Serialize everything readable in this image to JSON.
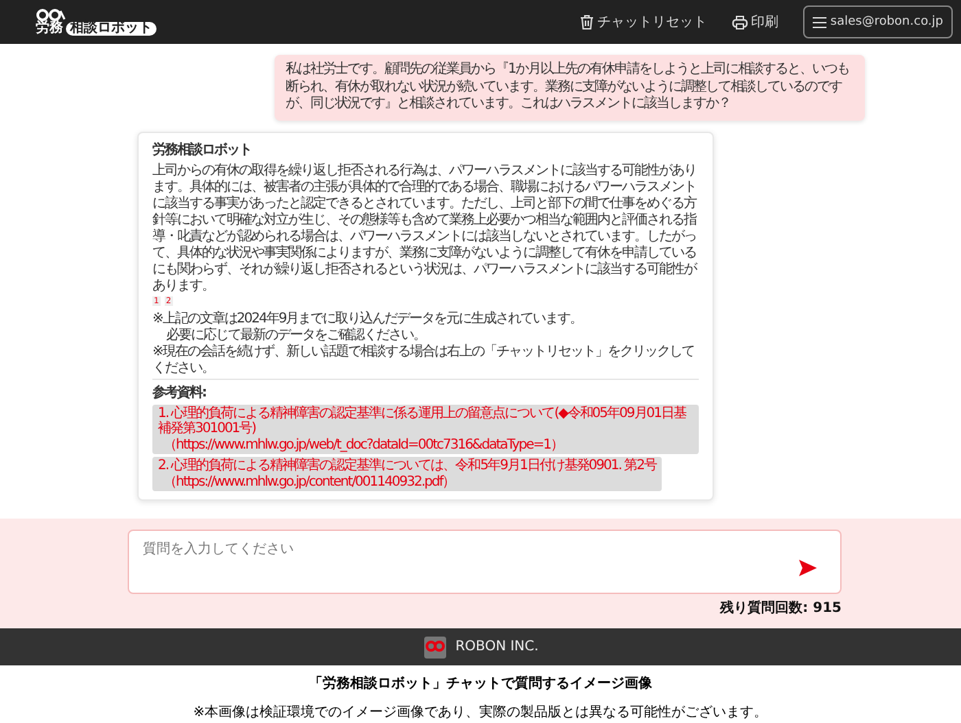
{
  "header": {
    "logo": {
      "top": "労務",
      "tag": "相談ロボット"
    },
    "actions": [
      {
        "kind": "reset",
        "label": "チャットリセット"
      },
      {
        "kind": "print",
        "label": "印刷"
      }
    ],
    "account": "sales@robon.co.jp"
  },
  "user_message": "私は社労士です。顧問先の従業員から『1か月以上先の有休申請をしようと上司に相談すると、いつも断られ、有休が取れない状況が続いています。業務に支障がないように調整して相談しているのですが、同じ状況です』と相談されています。これはハラスメントに該当しますか？",
  "bot_message": {
    "sender": "労務相談ロボット",
    "answer": "上司からの有休の取得を繰り返し拒否される行為は、パワーハラスメントに該当する可能性があります。具体的には、被害者の主張が具体的で合理的である場合、職場におけるパワーハラスメントに該当する事実があったと認定できるとされています。ただし、上司と部下の間で仕事をめぐる方針等において明確な対立が生じ、その態様等も含めて業務上必要かつ相当な範囲内と評価される指導・叱責などが認められる場合は、パワーハラスメントには該当しないとされています。したがって、具体的な状況や事実関係によりますが、業務に支障がないように調整して有休を申請しているにも関わらず、それが繰り返し拒否されるという状況は、パワーハラスメントに該当する可能性があります。",
    "citations": [
      "1",
      "2"
    ],
    "notes": [
      "※上記の文章は2024年9月までに取り込んだデータを元に生成されています。",
      "必要に応じて最新のデータをご確認ください。",
      "※現在の会話を続けず、新しい話題で相談する場合は右上の「チャットリセット」をクリックしてください。"
    ],
    "references_title": "参考資料:",
    "references": [
      {
        "title": "1. 心理的負荷による精神障害の認定基準に係る運用上の留意点について(◆令和05年09月01日基補発第301001号)",
        "url": "（https://www.mhlw.go.jp/web/t_doc?dataId=00tc7316&dataType=1）"
      },
      {
        "title": "2. 心理的負荷による精神障害の認定基準については、令和5年9月1日付け基発0901. 第2号",
        "url": "（https://www.mhlw.go.jp/content/001140932.pdf）"
      }
    ]
  },
  "input": {
    "placeholder": "質問を入力してください"
  },
  "remaining": "残り質問回数: 915",
  "footer": {
    "company": "ROBON INC."
  },
  "caption": {
    "title": "「労務相談ロボット」チャットで質問するイメージ画像",
    "note": "※本画像は検証環境でのイメージ画像であり、実際の製品版とは異なる可能性がございます。"
  }
}
